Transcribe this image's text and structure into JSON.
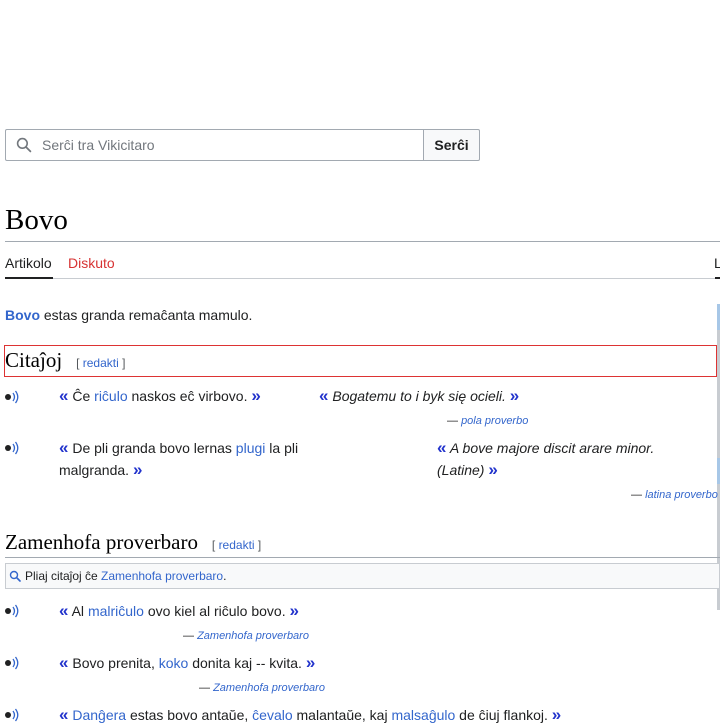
{
  "search": {
    "placeholder": "Serĉi tra Vikicitaro",
    "button_label": "Serĉi"
  },
  "page": {
    "title": "Bovo"
  },
  "tabs": {
    "article": "Artikolo",
    "discussion": "Diskuto",
    "right_cut": "L"
  },
  "intro": {
    "bold_link": "Bovo",
    "text": " estas granda remaĉanta mamulo."
  },
  "sections": {
    "citajxoj": {
      "title": "Citaĵoj",
      "edit_open": "[ ",
      "edit_link": "redakti",
      "edit_close": " ]"
    },
    "zamenhofa": {
      "title": "Zamenhofa proverbaro",
      "edit_open": "[ ",
      "edit_link": "redakti",
      "edit_close": " ]"
    }
  },
  "quotes": {
    "q1_left": {
      "open": "«",
      "p1": " Ĉe ",
      "link": "riĉulo",
      "p2": " naskos eĉ virbovo. ",
      "close": "»"
    },
    "q1_right": {
      "open": "«",
      "text": " Bogatemu to i byk się ocieli. ",
      "close": "»",
      "attr_dash": "— ",
      "attr_link": "pola proverbo"
    },
    "q2_left": {
      "open": "«",
      "p1": " De pli granda bovo lernas ",
      "link": "plugi",
      "p2": " la pli",
      "p3": "malgranda. ",
      "close": "»"
    },
    "q2_right": {
      "open": "«",
      "text1": " A bove majore discit arare minor.",
      "text2": "(Latine) ",
      "close": "»",
      "attr_dash": "— ",
      "attr_link": "latina proverbo"
    }
  },
  "zamenhof_note": {
    "p1": "Pliaj citaĵoj ĉe ",
    "link": "Zamenhofa proverbaro",
    "p2": "."
  },
  "zquotes": [
    {
      "open": "«",
      "p1": " Al ",
      "link": "malriĉulo",
      "p2": " ovo kiel al riĉulo bovo. ",
      "close": "»",
      "attr_dash": "— ",
      "attr_link": "Zamenhofa proverbaro"
    },
    {
      "open": "«",
      "p1": " Bovo prenita, ",
      "link": "koko",
      "p2": " donita kaj -- kvita. ",
      "close": "»",
      "attr_dash": "— ",
      "attr_link": "Zamenhofa proverbaro"
    },
    {
      "open": "«",
      "link1": "Danĝera",
      "p1": " estas bovo antaŭe, ",
      "link2": "ĉevalo",
      "p2": " malantaŭe, kaj ",
      "link3": "malsaĝulo",
      "p3": " de ĉiuj flankoj. ",
      "close": "»"
    }
  ],
  "icons": {
    "search": "magnifier-icon",
    "audio": "speaker-icon",
    "note": "magnifier-small-icon"
  }
}
